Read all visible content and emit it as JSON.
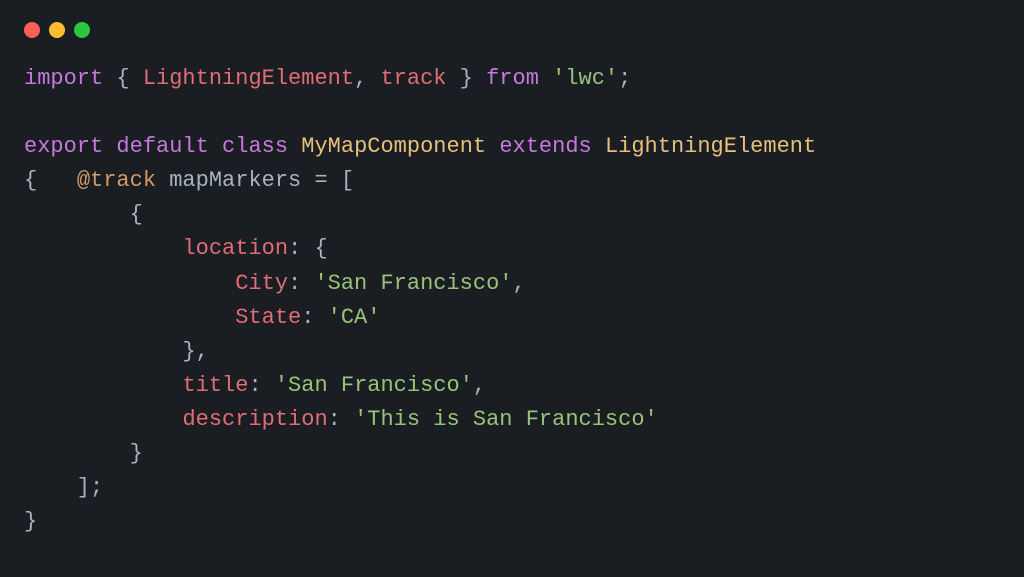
{
  "titlebar": {
    "dots": [
      "red",
      "yellow",
      "green"
    ]
  },
  "code": {
    "line1": {
      "t1": "import",
      "t2": " { ",
      "t3": "LightningElement",
      "t4": ", ",
      "t5": "track",
      "t6": " } ",
      "t7": "from",
      "t8": " ",
      "t9": "'lwc'",
      "t10": ";"
    },
    "line3": {
      "t1": "export",
      "t2": " ",
      "t3": "default",
      "t4": " ",
      "t5": "class",
      "t6": " ",
      "t7": "MyMapComponent",
      "t8": " ",
      "t9": "extends",
      "t10": " ",
      "t11": "LightningElement"
    },
    "line4": {
      "t1": "{   ",
      "t2": "@track",
      "t3": " mapMarkers = ["
    },
    "line5": {
      "t1": "        {"
    },
    "line6": {
      "t1": "            ",
      "t2": "location",
      "t3": ": {"
    },
    "line7": {
      "t1": "                ",
      "t2": "City",
      "t3": ": ",
      "t4": "'San Francisco'",
      "t5": ","
    },
    "line8": {
      "t1": "                ",
      "t2": "State",
      "t3": ": ",
      "t4": "'CA'"
    },
    "line9": {
      "t1": "            },"
    },
    "line10": {
      "t1": "            ",
      "t2": "title",
      "t3": ": ",
      "t4": "'San Francisco'",
      "t5": ","
    },
    "line11": {
      "t1": "            ",
      "t2": "description",
      "t3": ": ",
      "t4": "'This is San Francisco'"
    },
    "line12": {
      "t1": "        }"
    },
    "line13": {
      "t1": "    ];"
    },
    "line14": {
      "t1": "}"
    }
  }
}
